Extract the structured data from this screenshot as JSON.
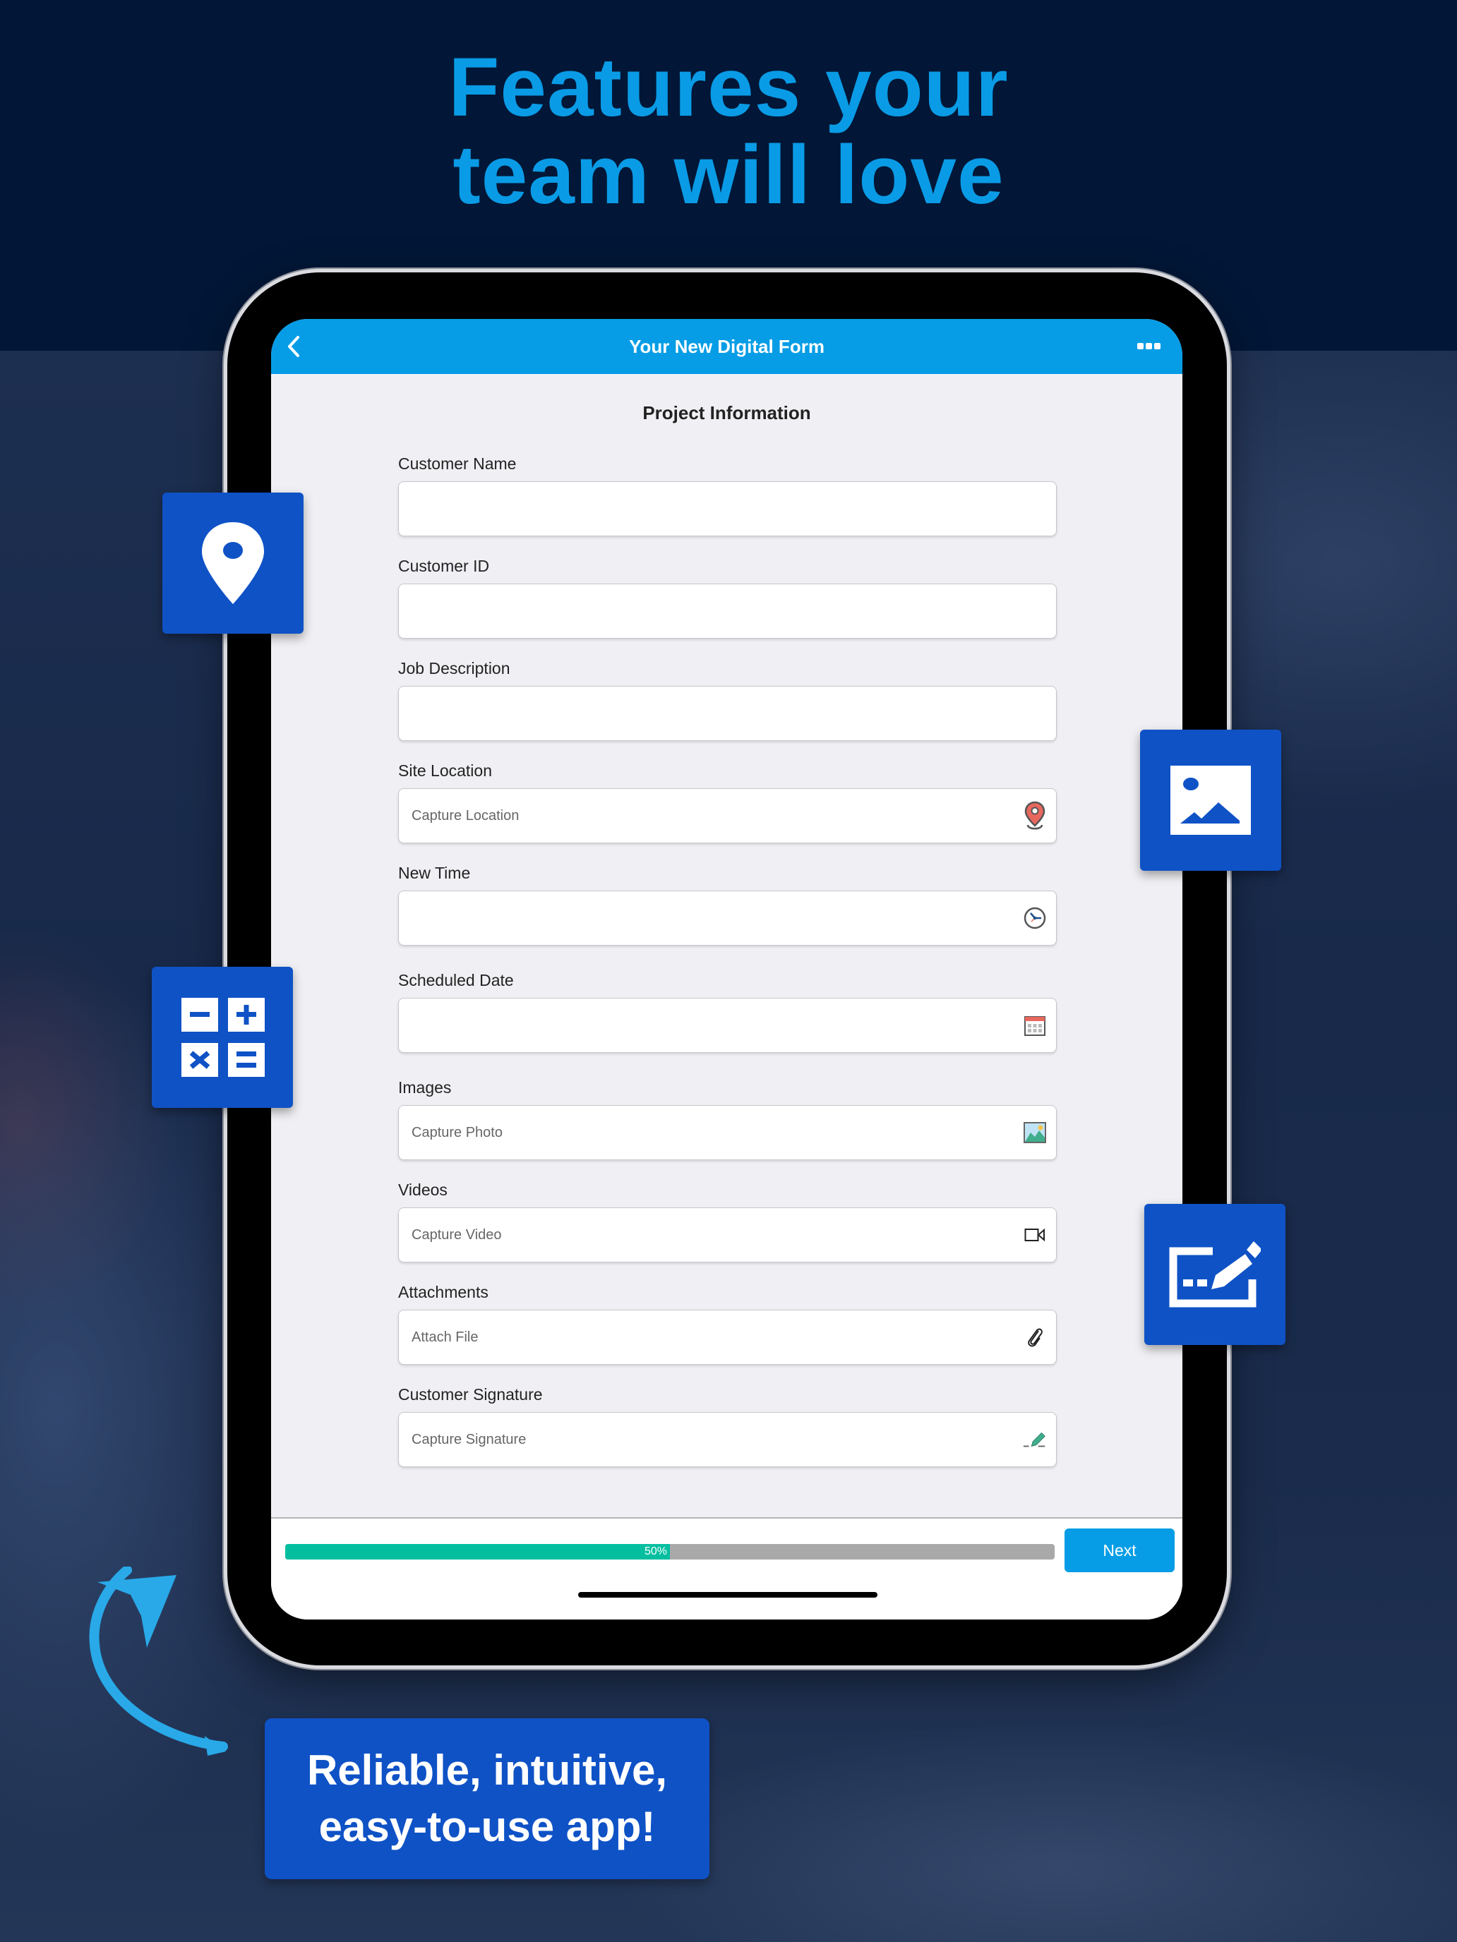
{
  "headline": {
    "line1": "Features your",
    "line2": "team will love"
  },
  "app": {
    "title": "Your New Digital Form",
    "back_icon": "chevron-left-icon",
    "more_icon": "ellipsis-icon",
    "section_title": "Project Information",
    "fields": [
      {
        "label": "Customer Name",
        "placeholder": "",
        "icon": null
      },
      {
        "label": "Customer ID",
        "placeholder": "",
        "icon": null
      },
      {
        "label": "Job Description",
        "placeholder": "",
        "icon": null
      },
      {
        "label": "Site Location",
        "placeholder": "Capture Location",
        "icon": "map-pin-icon"
      },
      {
        "label": "New Time",
        "placeholder": "",
        "icon": "clock-icon"
      },
      {
        "label": "Scheduled Date",
        "placeholder": "",
        "icon": "calendar-icon"
      },
      {
        "label": "Images",
        "placeholder": "Capture Photo",
        "icon": "image-icon"
      },
      {
        "label": "Videos",
        "placeholder": "Capture Video",
        "icon": "video-camera-icon"
      },
      {
        "label": "Attachments",
        "placeholder": "Attach File",
        "icon": "paperclip-icon"
      },
      {
        "label": "Customer Signature",
        "placeholder": "Capture Signature",
        "icon": "signature-pen-icon"
      }
    ],
    "progress": {
      "percent": 50,
      "label": "50%"
    },
    "next_label": "Next"
  },
  "tiles": [
    {
      "icon": "location-pin-icon"
    },
    {
      "icon": "calculator-icon"
    },
    {
      "icon": "image-icon"
    },
    {
      "icon": "signature-icon"
    }
  ],
  "tagline": {
    "line1": "Reliable, intuitive,",
    "line2": "easy-to-use app!"
  },
  "colors": {
    "brand_blue": "#0F52C6",
    "header_blue": "#069DE6",
    "headline_blue": "#0A9BE6",
    "progress_green": "#03BFA0",
    "background_navy": "#021737"
  }
}
